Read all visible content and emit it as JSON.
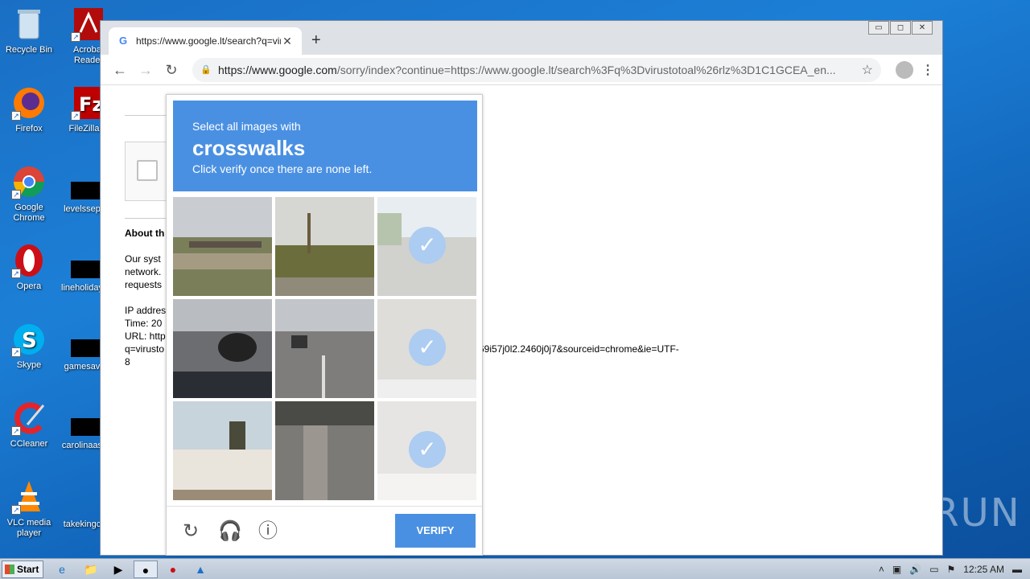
{
  "desktop": {
    "icons": [
      {
        "label": "Recycle Bin"
      },
      {
        "label": "Acrobat Reader"
      },
      {
        "label": "Firefox"
      },
      {
        "label": "FileZilla C"
      },
      {
        "label": "Google Chrome"
      },
      {
        "label": "levelssep"
      },
      {
        "label": "Opera"
      },
      {
        "label": "lineholiday"
      },
      {
        "label": "Skype"
      },
      {
        "label": "gamesav"
      },
      {
        "label": "CCleaner"
      },
      {
        "label": "carolinaas"
      },
      {
        "label": "VLC media player"
      },
      {
        "label": "takekingc"
      }
    ],
    "watermark": "ANY RUN"
  },
  "browser": {
    "tab_title": "https://www.google.lt/search?q=vir",
    "url_host": "https://www.google.com",
    "url_rest": "/sorry/index?continue=https://www.google.lt/search%3Fq%3Dvirustotoal%26rlz%3D1C1GCEA_en...",
    "window_controls": [
      "▭",
      "◻",
      "✕"
    ]
  },
  "page": {
    "about_heading": "About th",
    "para1_line1": "Our syst",
    "para1_line2": "network.",
    "para1_line3": "requests",
    "ip_line": "IP addres",
    "time_line": "Time: 20",
    "url_line": "URL: http",
    "q_line": "q=virusto",
    "q_line_tail": "69i57j0l2.2460j0j7&sourceid=chrome&ie=UTF-",
    "q_line_end": "8"
  },
  "captcha": {
    "instruction": "Select all images with",
    "target": "crosswalks",
    "subtext": "Click verify once there are none left.",
    "verify_label": "VERIFY",
    "tiles": [
      {
        "selected": false
      },
      {
        "selected": false
      },
      {
        "selected": true
      },
      {
        "selected": false
      },
      {
        "selected": false
      },
      {
        "selected": true
      },
      {
        "selected": false
      },
      {
        "selected": false
      },
      {
        "selected": true
      }
    ]
  },
  "taskbar": {
    "start_label": "Start",
    "clock": "12:25 AM"
  }
}
